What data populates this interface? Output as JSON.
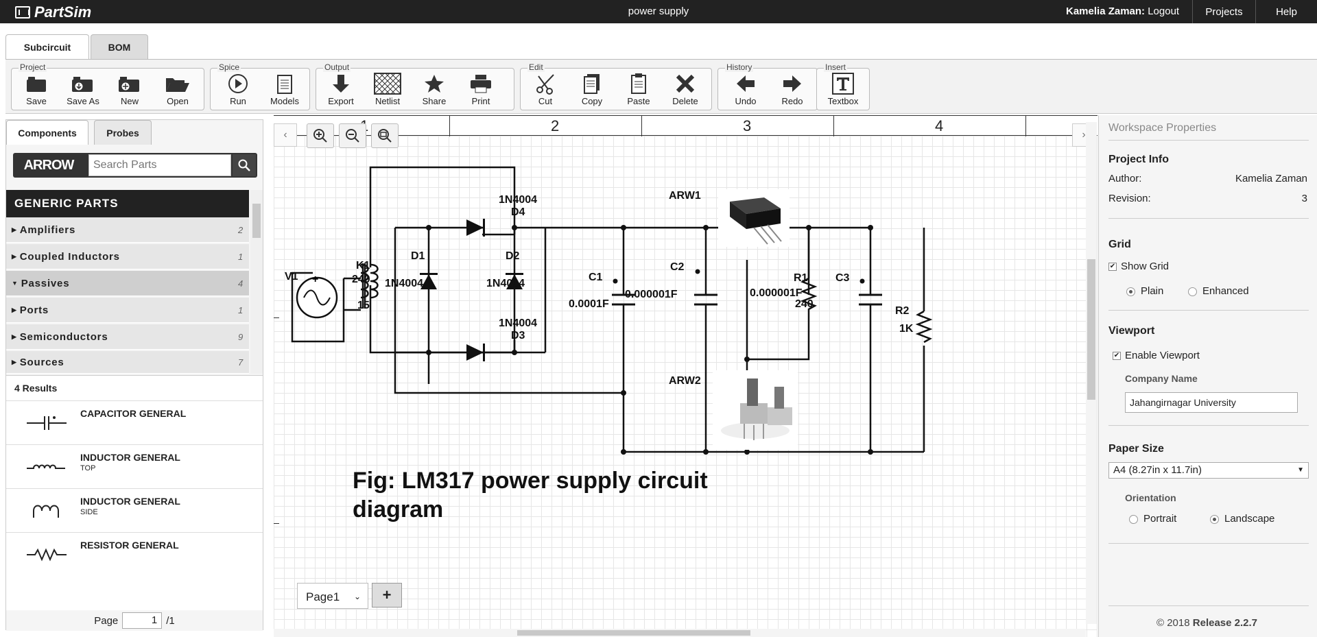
{
  "app": {
    "name": "PartSim",
    "doc_title": "power supply"
  },
  "user": {
    "name": "Kamelia Zaman:",
    "logout": "Logout"
  },
  "topnav": {
    "projects": "Projects",
    "help": "Help"
  },
  "main_tabs": [
    "Subcircuit",
    "BOM"
  ],
  "toolbar": {
    "groups": [
      "Project",
      "Spice",
      "Output",
      "Edit",
      "History",
      "Insert"
    ],
    "buttons": [
      "Save",
      "Save As",
      "New",
      "Open",
      "Run",
      "Models",
      "Export",
      "Netlist",
      "Share",
      "Print",
      "Cut",
      "Copy",
      "Paste",
      "Delete",
      "Undo",
      "Redo",
      "Textbox"
    ]
  },
  "left": {
    "tabs": [
      "Components",
      "Probes"
    ],
    "brand": "ARROW",
    "search_placeholder": "Search Parts",
    "header": "GENERIC PARTS",
    "categories": [
      {
        "label": "Amplifiers",
        "count": "2"
      },
      {
        "label": "Coupled Inductors",
        "count": "1"
      },
      {
        "label": "Passives",
        "count": "4"
      },
      {
        "label": "Ports",
        "count": "1"
      },
      {
        "label": "Semiconductors",
        "count": "9"
      },
      {
        "label": "Sources",
        "count": "7"
      }
    ],
    "results_count": "4 Results",
    "results": [
      {
        "name": "CAPACITOR GENERAL",
        "sub": ""
      },
      {
        "name": "INDUCTOR GENERAL",
        "sub": "TOP"
      },
      {
        "name": "INDUCTOR GENERAL",
        "sub": "SIDE"
      },
      {
        "name": "RESISTOR GENERAL",
        "sub": ""
      }
    ],
    "pager": {
      "label": "Page",
      "current": "1",
      "total": "/1"
    }
  },
  "canvas": {
    "ruler": [
      "1",
      "2",
      "3",
      "4"
    ],
    "page_name": "Page1",
    "add_page": "+",
    "caption_line1": "Fig: LM317 power supply circuit",
    "caption_line2": "diagram",
    "labels": {
      "v1": "V1",
      "k1": "K1",
      "k1_primary": "240",
      "k1_secondary": "15",
      "d1": "D1",
      "d1_part": "1N4004",
      "d2": "D2",
      "d2_part": "1N4004",
      "d3": "D3",
      "d3_part": "1N4004",
      "d4": "D4",
      "d4_part": "1N4004",
      "c1": "C1",
      "c1_val": "0.0001F",
      "c2": "C2",
      "c2_val": "0.000001F",
      "c3": "C3",
      "c3_val": "0.000001F",
      "r1": "R1",
      "r1_val": "240",
      "r2": "R2",
      "r2_val": "1K",
      "arw1": "ARW1",
      "arw2": "ARW2"
    }
  },
  "right": {
    "title": "Workspace Properties",
    "project_info": "Project Info",
    "author_label": "Author:",
    "author": "Kamelia Zaman",
    "revision_label": "Revision:",
    "revision": "3",
    "grid": "Grid",
    "show_grid": "Show Grid",
    "plain": "Plain",
    "enhanced": "Enhanced",
    "viewport": "Viewport",
    "enable_viewport": "Enable Viewport",
    "company_label": "Company Name",
    "company": "Jahangirnagar University",
    "paper_size": "Paper Size",
    "paper_value": "A4 (8.27in x 11.7in)",
    "orientation": "Orientation",
    "portrait": "Portrait",
    "landscape": "Landscape",
    "copyright": "© 2018",
    "release": "Release 2.2.7"
  }
}
